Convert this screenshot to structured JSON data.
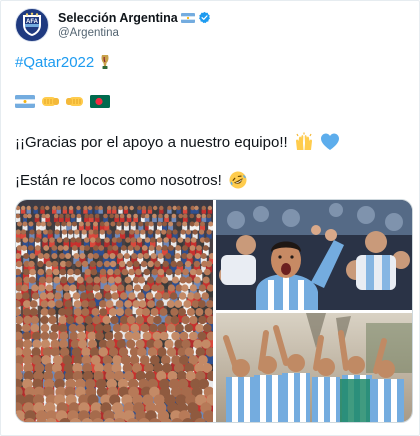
{
  "account": {
    "display_name": "Selección Argentina",
    "handle": "@Argentina",
    "avatar_icon": "afa-crest-icon",
    "verified_icon": "verified-badge-icon",
    "name_flag_icon": "argentina-flag-icon"
  },
  "tweet": {
    "hashtag": "#Qatar2022",
    "hashtag_emoji": "trophy-icon",
    "emoji_line": [
      "argentina-flag-icon",
      "fist-right-icon",
      "fist-left-icon",
      "bangladesh-flag-icon"
    ],
    "line1": "¡¡Gracias por el apoyo a nuestro equipo!!",
    "line1_emojis": [
      "raising-hands-icon",
      "blue-heart-icon"
    ],
    "line2": "¡Están re locos como nosotros!",
    "line2_emojis": [
      "rolling-laughing-icon"
    ]
  },
  "media": {
    "images": [
      {
        "name": "crowd-photo",
        "alt": ""
      },
      {
        "name": "boy-cheering-photo",
        "alt": ""
      },
      {
        "name": "fans-celebrating-photo",
        "alt": ""
      }
    ]
  },
  "colors": {
    "link": "#1d9bf0",
    "verified": "#1d9bf0",
    "argentina_blue": "#74acdf",
    "bangladesh_green": "#006a4e",
    "bangladesh_red": "#f42a41"
  }
}
